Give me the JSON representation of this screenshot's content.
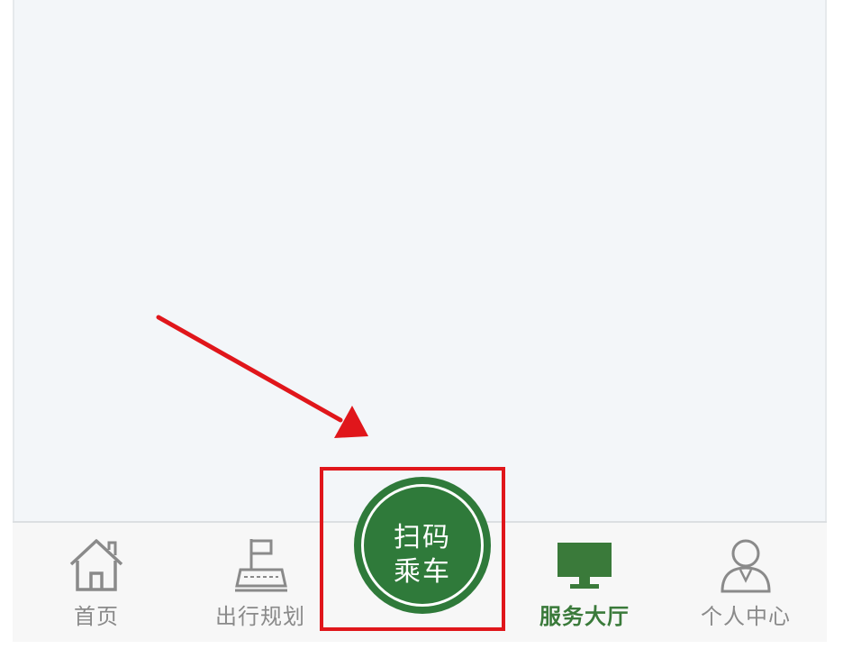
{
  "tabbar": {
    "tabs": [
      {
        "label": "首页",
        "icon": "home-icon",
        "active": false
      },
      {
        "label": "出行规划",
        "icon": "trip-plan-icon",
        "active": false
      },
      {
        "label": "服务大厅",
        "icon": "monitor-icon",
        "active": true
      },
      {
        "label": "个人中心",
        "icon": "user-icon",
        "active": false
      }
    ],
    "scan_button": {
      "line1": "扫码",
      "line2": "乘车"
    }
  },
  "annotation": {
    "highlight_color": "#e0161b",
    "arrow_color": "#e0161b"
  },
  "colors": {
    "accent": "#2f7a3a",
    "inactive": "#8a8a8a",
    "background": "#f3f6f9"
  }
}
